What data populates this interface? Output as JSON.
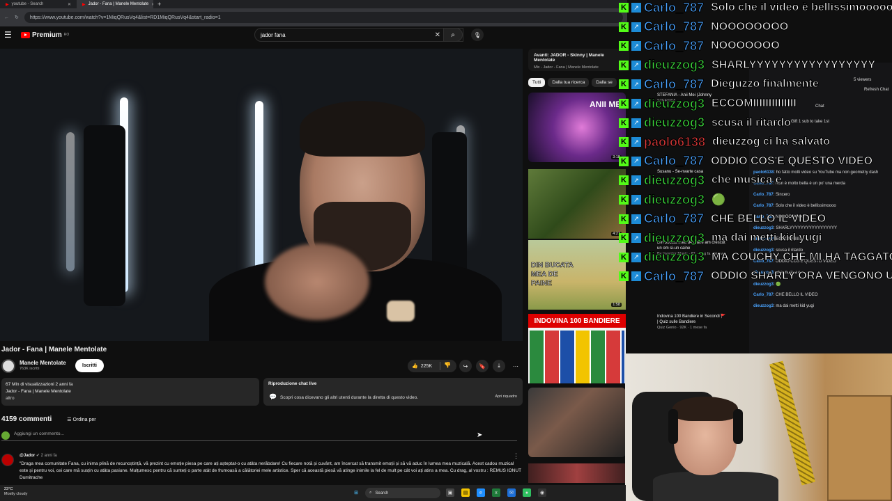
{
  "browser": {
    "tabs": [
      {
        "label": "youtube - Search"
      },
      {
        "label": "Jador - Fana | Manele Mentolate"
      }
    ],
    "url": "https://www.youtube.com/watch?v=1MiqQRusVq4&list=RD1MiqQRusVq4&start_radio=1"
  },
  "youtube": {
    "logo": "Premium",
    "logo_sup": "RO",
    "search_value": "jador fana",
    "video_title": "Jador - Fana | Manele Mentolate",
    "channel_name": "Manele Mentolate",
    "channel_subs": "763K iscritti",
    "subscribe_label": "Iscritti",
    "likes": "225K",
    "desc_views": "67 Mln di visualizzazioni  2 anni fa",
    "desc_text": "Jador - Fana | Manele Mentolate",
    "desc_more": "altro",
    "live_title": "Riproduzione chat live",
    "live_text": "Scopri cosa dicevano gli altri utenti durante la diretta di questo video.",
    "live_open": "Apri riquadro",
    "comments_count": "4159 commenti",
    "sort_label": "Ordina per",
    "add_comment": "Aggiungi un commento...",
    "comment_author": "@Jador",
    "comment_time": "2 anni fa",
    "comment_body": "\"Draga mea comunitate Fana, cu inima plină de recunoștință, vă prezint cu emoție piesa pe care ați așteptat-o cu atâta nerăbdare! Cu fiecare notă și cuvânt, am încercat să transmit emoții și să vă aduc în lumea mea muzicală. Acest cadou muzical este și pentru voi, cei care mă susțin cu atâta pasiune. Mulțumesc pentru că sunteți o parte atât de frumoasă a călătoriei mele artistice. Sper că această piesă vă atinge inimile la fel de mult pe cât voi ați atins a mea. Cu drag,  al vostru : REMUS IONUT Dumitrache",
    "upnext_title": "Avanti: JADOR - Skinny | Manele Mentolate",
    "upnext_sub": "Mix - Jador - Fana | Manele Mentolate",
    "chips": [
      "Tutti",
      "Dalla tua ricerca",
      "Dalla se"
    ],
    "recs": [
      {
        "title": "STEFANIA - Anii Mei (Johnny",
        "sub": "STEFANIA",
        "thumb_text": "ANII MEI",
        "dur": "3:18"
      },
      {
        "title": "Susanu - Se-nvarte casa",
        "sub": "",
        "thumb_text": "",
        "dur": "4:27"
      },
      {
        "title": "Din bucata mea de paine am crescut un om si-un caine",
        "sub": "By Inventor Music · 83 · 5 gg fa · Nuovo",
        "thumb_text": "DIN BUCATA MEA DE PAINE",
        "dur": "1:58"
      },
      {
        "title": "Indovina 100 Bandiere in Secondi 🚩 | Quiz sulle Bandiere",
        "sub": "Quiz Genio · 92K · 1 mese fa",
        "thumb_text": "INDOVINA 100 BANDIERE",
        "dur": ""
      },
      {
        "title": "",
        "sub": "",
        "thumb_text": "",
        "dur": ""
      }
    ]
  },
  "chat_overlay": [
    {
      "user": "Carlo_787",
      "text": "Solo che il video è bellissimooooo",
      "color": "#4aa3ff"
    },
    {
      "user": "Carlo_787",
      "text": "NOOOOOOOO",
      "color": "#4aa3ff"
    },
    {
      "user": "Carlo_787",
      "text": "NOOOOOOO",
      "color": "#4aa3ff"
    },
    {
      "user": "dieuzzog3",
      "text": "SHARLYYYYYYYYYYYYYYYYY",
      "color": "#3ddc3d"
    },
    {
      "user": "Carlo_787",
      "text": "Dieguzzo finalmente",
      "color": "#4aa3ff"
    },
    {
      "user": "dieuzzog3",
      "text": "ECCOMIIIIIIIIIIIIII",
      "color": "#3ddc3d"
    },
    {
      "user": "dieuzzog3",
      "text": "scusa il ritardo",
      "color": "#3ddc3d"
    },
    {
      "user": "paolo6138",
      "text": "dieuzzog ci ha salvato",
      "color": "#e03a3a"
    },
    {
      "user": "Carlo_787",
      "text": "ODDIO COS'E QUESTO VIDEO",
      "color": "#4aa3ff"
    },
    {
      "user": "dieuzzog3",
      "text": "che musica e",
      "color": "#3ddc3d"
    },
    {
      "user": "dieuzzog3",
      "text": "🟢",
      "color": "#3ddc3d"
    },
    {
      "user": "Carlo_787",
      "text": "CHE BELLO IL VIDEO",
      "color": "#4aa3ff"
    },
    {
      "user": "dieuzzog3",
      "text": "ma dai metti kid yugi",
      "color": "#3ddc3d"
    },
    {
      "user": "dieuzzog3",
      "text": "MA COUCHY CHE MI HA TAGGATO?",
      "color": "#3ddc3d"
    },
    {
      "user": "Carlo_787",
      "text": "ODDIO SHARLY ORA VENGONO UN SACCO DI SPETTATORI",
      "color": "#4aa3ff"
    }
  ],
  "twitch_panel": {
    "viewers": "5 viewers",
    "refresh": "Refresh Chat",
    "chat_label": "Chat",
    "gift": "Gift 1 sub to take 1st",
    "lines": [
      {
        "user": "paolo6138",
        "text": "ho fatto molti video su YouTube ma non geometry dash"
      },
      {
        "user": "Carlo_787",
        "text": "Non è molto bella è un po' una merda"
      },
      {
        "user": "Carlo_787",
        "text": "Sincero"
      },
      {
        "user": "Carlo_787",
        "text": "Solo che il video è bellissimoooo"
      },
      {
        "user": "Carlo_787",
        "text": "NOOOOOOOO"
      },
      {
        "user": "dieuzzog3",
        "text": "SHARLYYYYYYYYYYYYYYYYY"
      },
      {
        "user": "dieuzzog3",
        "text": "ECCOMIIIIIIIII"
      },
      {
        "user": "dieuzzog3",
        "text": "scusa il ritardo"
      },
      {
        "user": "Carlo_787",
        "text": "ODDIO COS'E QUESTO VIDEO"
      },
      {
        "user": "dieuzzog3",
        "text": "che musica e"
      },
      {
        "user": "dieuzzog3",
        "text": "🟢"
      },
      {
        "user": "Carlo_787",
        "text": "CHE BELLO IL VIDEO"
      },
      {
        "user": "dieuzzog3",
        "text": "ma dai metti kid yugi"
      }
    ]
  },
  "taskbar": {
    "temp": "23°C",
    "weather": "Mostly cloudy",
    "search": "Search"
  },
  "colors": {
    "youtube_red": "#ff0000",
    "kick_green": "#53fc18",
    "bg": "#0f0f0f"
  }
}
